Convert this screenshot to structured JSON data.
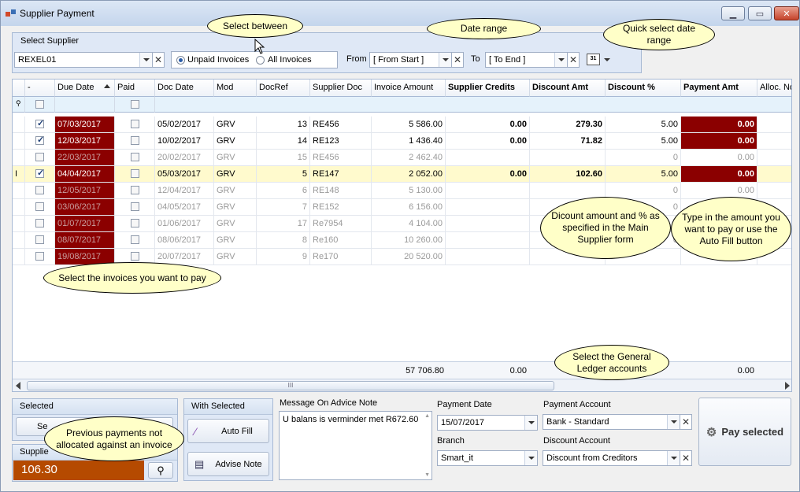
{
  "window": {
    "title": "Supplier Payment"
  },
  "filter": {
    "group_label": "Select Supplier",
    "supplier": "REXEL01",
    "opt_unpaid": "Unpaid Invoices",
    "opt_all": "All Invoices",
    "from_label": "From",
    "from_value": "[ From Start ]",
    "to_label": "To",
    "to_value": "[ To End ]",
    "cal_label": "31"
  },
  "grid": {
    "columns": [
      "-",
      "Due Date",
      "Paid",
      "Doc Date",
      "Mod",
      "DocRef",
      "Supplier Doc",
      "Invoice Amount",
      "Supplier Credits",
      "Discount Amt",
      "Discount %",
      "Payment Amt",
      "Alloc. No"
    ],
    "rows": [
      {
        "sel": true,
        "due": "07/03/2017",
        "doc": "05/02/2017",
        "mod": "GRV",
        "ref": "13",
        "sdoc": "RE456",
        "inv": "5 586.00",
        "cred": "0.00",
        "disc": "279.30",
        "pct": "5.00",
        "pay": "0.00"
      },
      {
        "sel": true,
        "due": "12/03/2017",
        "doc": "10/02/2017",
        "mod": "GRV",
        "ref": "14",
        "sdoc": "RE123",
        "inv": "1 436.40",
        "cred": "0.00",
        "disc": "71.82",
        "pct": "5.00",
        "pay": "0.00"
      },
      {
        "sel": false,
        "due": "22/03/2017",
        "doc": "20/02/2017",
        "mod": "GRV",
        "ref": "15",
        "sdoc": "RE456",
        "inv": "2 462.40",
        "cred": "",
        "disc": "",
        "pct": "0",
        "pay": "0.00"
      },
      {
        "sel": true,
        "due": "04/04/2017",
        "doc": "05/03/2017",
        "mod": "GRV",
        "ref": "5",
        "sdoc": "RE147",
        "inv": "2 052.00",
        "cred": "0.00",
        "disc": "102.60",
        "pct": "5.00",
        "pay": "0.00"
      },
      {
        "sel": false,
        "due": "12/05/2017",
        "doc": "12/04/2017",
        "mod": "GRV",
        "ref": "6",
        "sdoc": "RE148",
        "inv": "5 130.00",
        "cred": "",
        "disc": "",
        "pct": "0",
        "pay": "0.00"
      },
      {
        "sel": false,
        "due": "03/06/2017",
        "doc": "04/05/2017",
        "mod": "GRV",
        "ref": "7",
        "sdoc": "RE152",
        "inv": "6 156.00",
        "cred": "",
        "disc": "",
        "pct": "0",
        "pay": ""
      },
      {
        "sel": false,
        "due": "01/07/2017",
        "doc": "01/06/2017",
        "mod": "GRV",
        "ref": "17",
        "sdoc": "Re7954",
        "inv": "4 104.00",
        "cred": "",
        "disc": "",
        "pct": "0",
        "pay": ""
      },
      {
        "sel": false,
        "due": "08/07/2017",
        "doc": "08/06/2017",
        "mod": "GRV",
        "ref": "8",
        "sdoc": "Re160",
        "inv": "10 260.00",
        "cred": "",
        "disc": "",
        "pct": "0",
        "pay": ""
      },
      {
        "sel": false,
        "due": "19/08/2017",
        "doc": "20/07/2017",
        "mod": "GRV",
        "ref": "9",
        "sdoc": "Re170",
        "inv": "20 520.00",
        "cred": "",
        "disc": "",
        "pct": "",
        "pay": ""
      }
    ],
    "totals": {
      "inv": "57 706.80",
      "cred": "0.00",
      "pay": "0.00"
    },
    "row_cursor": "I",
    "scroll_grip": "III"
  },
  "bottom": {
    "selected_title": "Selected",
    "selected_btn": "Se",
    "supplier_title": "Supplie",
    "supplier_amount": "106.30",
    "with_selected_title": "With Selected",
    "autofill_label": "Auto Fill",
    "advise_label": "Advise Note",
    "message_label": "Message On Advice Note",
    "message_text": "U balans is verminder met R672.60",
    "payment_date_label": "Payment Date",
    "payment_date": "15/07/2017",
    "branch_label": "Branch",
    "branch": "Smart_it",
    "payment_account_label": "Payment Account",
    "payment_account": "Bank - Standard",
    "discount_account_label": "Discount Account",
    "discount_account": "Discount  from Creditors",
    "pay_selected": "Pay selected"
  },
  "callouts": {
    "select_between": "Select between",
    "date_range": "Date range",
    "quick_select": "Quick select date range",
    "discount_note": "Dicount amount and % as specified in the Main Supplier form",
    "type_amount": "Type in the amount you want to pay or use the Auto Fill button",
    "select_invoices": "Select the invoices you want to pay",
    "gl_accounts": "Select the General Ledger accounts",
    "previous_payments": "Previous payments not allocated against an invoice"
  },
  "colors": {
    "overdue": "#8b0000",
    "selected_row": "#fffacd",
    "supplier_amount_bg": "#b54a00",
    "callout": "#ffffc8"
  }
}
